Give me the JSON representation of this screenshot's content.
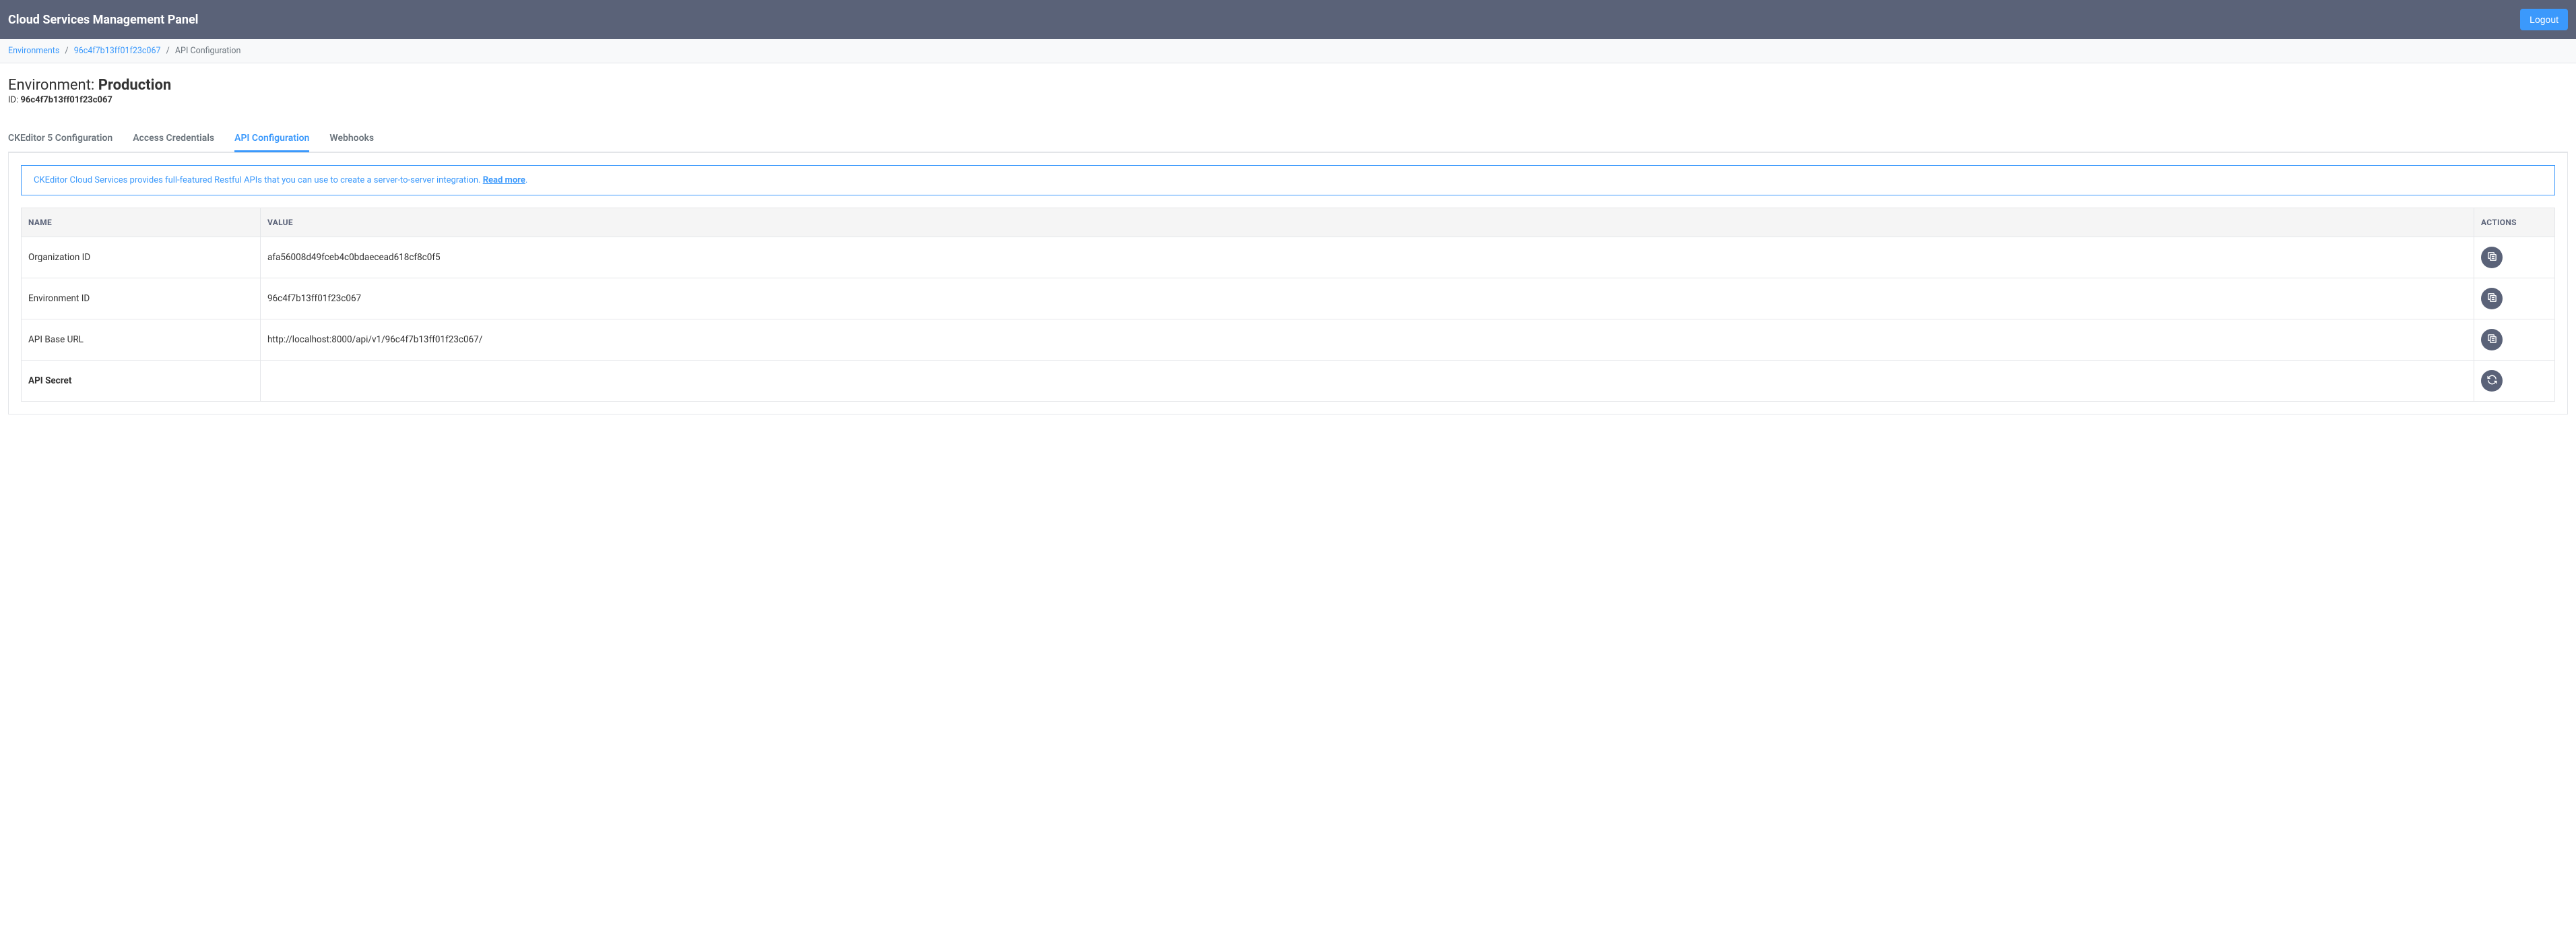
{
  "header": {
    "title": "Cloud Services Management Panel",
    "logout_label": "Logout"
  },
  "breadcrumb": {
    "items": [
      {
        "label": "Environments",
        "link": true
      },
      {
        "label": "96c4f7b13ff01f23c067",
        "link": true
      },
      {
        "label": "API Configuration",
        "link": false
      }
    ]
  },
  "env": {
    "prefix": "Environment: ",
    "name": "Production",
    "id_prefix": "ID: ",
    "id": "96c4f7b13ff01f23c067"
  },
  "tabs": [
    {
      "label": "CKEditor 5 Configuration",
      "active": false
    },
    {
      "label": "Access Credentials",
      "active": false
    },
    {
      "label": "API Configuration",
      "active": true
    },
    {
      "label": "Webhooks",
      "active": false
    }
  ],
  "banner": {
    "text": "CKEditor Cloud Services provides full-featured Restful APIs that you can use to create a server-to-server integration. ",
    "link_text": "Read more",
    "suffix": "."
  },
  "table": {
    "headers": {
      "name": "NAME",
      "value": "VALUE",
      "actions": "ACTIONS"
    },
    "rows": [
      {
        "name": "Organization ID",
        "value": "afa56008d49fceb4c0bdaecead618cf8c0f5",
        "action": "copy",
        "bold": false
      },
      {
        "name": "Environment ID",
        "value": "96c4f7b13ff01f23c067",
        "action": "copy",
        "bold": false
      },
      {
        "name": "API Base URL",
        "value": "http://localhost:8000/api/v1/96c4f7b13ff01f23c067/",
        "action": "copy",
        "bold": false
      },
      {
        "name": "API Secret",
        "value": "",
        "action": "refresh",
        "bold": true
      }
    ]
  }
}
